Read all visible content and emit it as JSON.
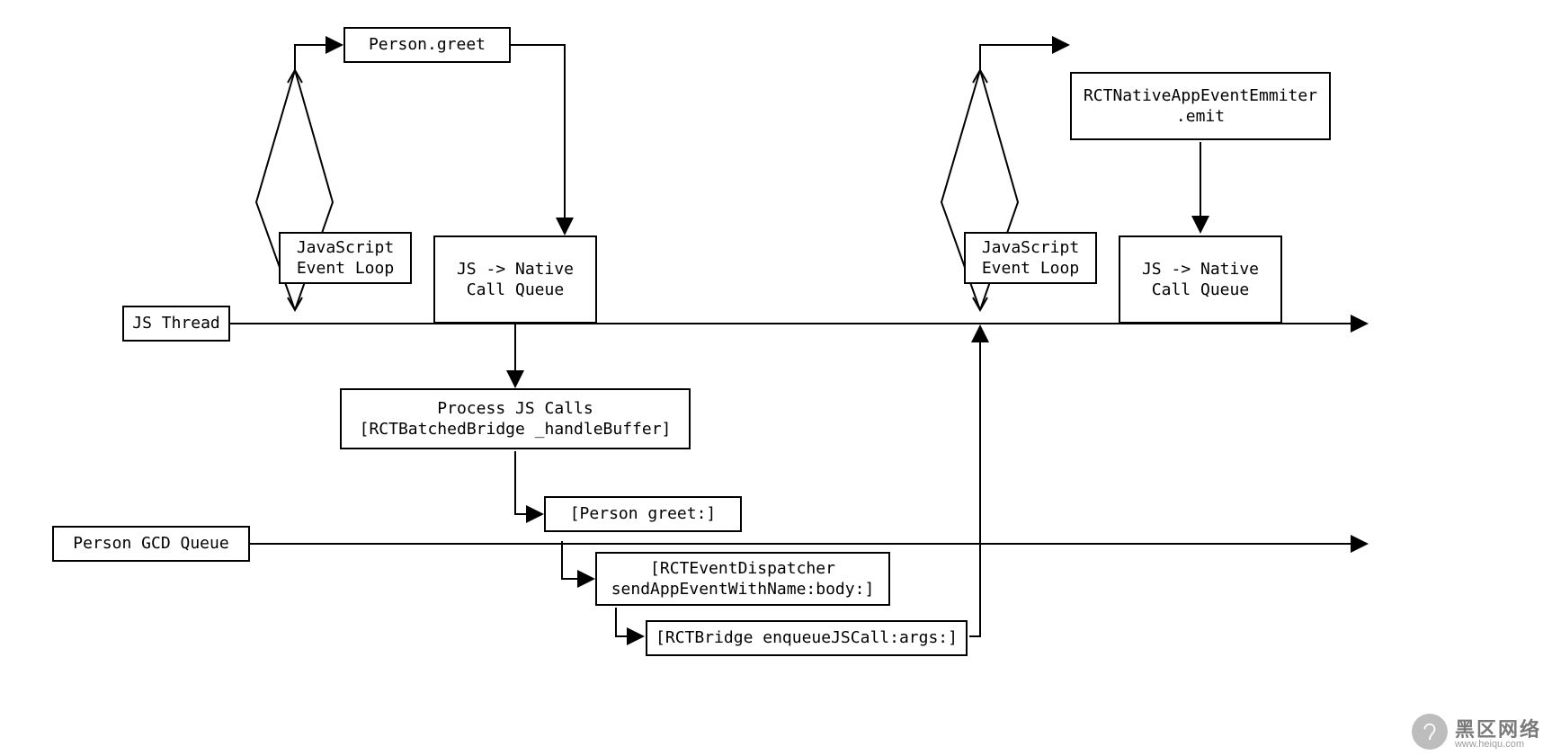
{
  "lanes": {
    "js_thread_label": "JS Thread",
    "gcd_queue_label": "Person GCD Queue"
  },
  "left": {
    "person_greet": "Person.greet",
    "event_loop": "JavaScript\nEvent Loop",
    "call_queue": "JS -> Native\nCall Queue",
    "process_calls": "Process JS Calls\n[RCTBatchedBridge _handleBuffer]",
    "person_greet_native": "[Person greet:]",
    "event_dispatcher": "[RCTEventDispatcher\nsendAppEventWithName:body:]",
    "enqueue_js_call": "[RCTBridge enqueueJSCall:args:]"
  },
  "right": {
    "emitter": "RCTNativeAppEventEmmiter\n.emit",
    "event_loop": "JavaScript\nEvent Loop",
    "call_queue": "JS -> Native\nCall Queue"
  },
  "watermark": {
    "big": "黑区网络",
    "small": "www.heiqu.com"
  }
}
